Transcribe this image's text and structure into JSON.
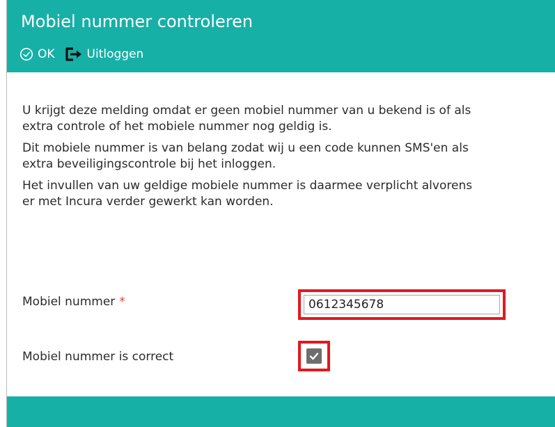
{
  "dialog": {
    "title": "Mobiel nummer controleren"
  },
  "toolbar": {
    "ok_label": "OK",
    "ok_icon": "check-circle-icon",
    "logout_label": "Uitloggen",
    "logout_icon": "logout-icon"
  },
  "messages": [
    "U krijgt deze melding omdat er geen mobiel nummer van u bekend is of als extra controle of het mobiele nummer nog geldig is.",
    "Dit mobiele nummer is van belang zodat wij u een code kunnen SMS'en als extra beveiligingscontrole bij het inloggen.",
    "Het invullen van uw geldige mobiele nummer is daarmee verplicht alvorens er met Incura verder gewerkt kan worden."
  ],
  "form": {
    "phone_label": "Mobiel nummer",
    "required_mark": "*",
    "phone_value": "0612345678",
    "confirm_label": "Mobiel nummer is correct",
    "confirm_checked": true
  },
  "colors": {
    "brand": "#16b0a7",
    "highlight": "#e2191f",
    "required": "#e0443a"
  }
}
